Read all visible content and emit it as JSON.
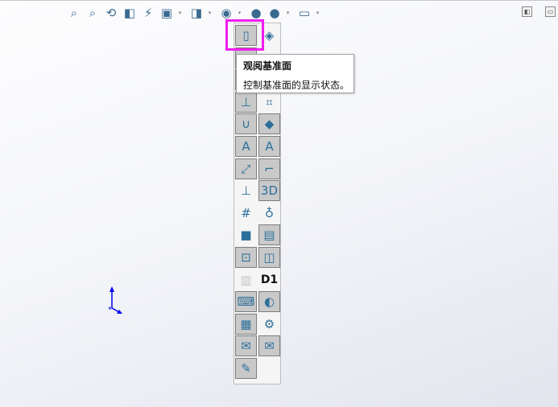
{
  "toolbar": {
    "items": [
      {
        "icon": "zoom-to-fit-icon",
        "glyph": "⌕"
      },
      {
        "icon": "zoom-to-area-icon",
        "glyph": "⌕"
      },
      {
        "icon": "previous-view-icon",
        "glyph": "⟲"
      },
      {
        "icon": "section-view-icon",
        "glyph": "◧"
      },
      {
        "icon": "dynamic-annotation-views-icon",
        "glyph": "⚡"
      },
      {
        "icon": "view-orientation-icon",
        "glyph": "▣"
      },
      {
        "icon": "display-style-icon",
        "glyph": "◨"
      },
      {
        "icon": "hide-show-items-icon",
        "glyph": "◉"
      },
      {
        "icon": "edit-appearance-icon",
        "glyph": "●"
      },
      {
        "icon": "apply-scene-icon",
        "glyph": "●"
      },
      {
        "icon": "view-settings-icon",
        "glyph": "▭"
      }
    ],
    "dropdown_glyph": "▾"
  },
  "window_buttons": [
    "◧",
    "▭"
  ],
  "flyout": {
    "items": [
      {
        "name": "view-planes",
        "glyph": "▯",
        "on": true
      },
      {
        "name": "view-axes",
        "glyph": "◈",
        "on": false
      },
      {
        "name": "hidden-item-1",
        "glyph": "",
        "on": true
      },
      {
        "name": "hidden-item-2",
        "glyph": "",
        "on": false
      },
      {
        "name": "hidden-item-3",
        "glyph": "",
        "on": true
      },
      {
        "name": "hidden-item-4",
        "glyph": "",
        "on": false
      },
      {
        "name": "view-coordinate-systems",
        "glyph": "⊥",
        "on": true
      },
      {
        "name": "view-sketch-text",
        "glyph": "⌗",
        "on": false
      },
      {
        "name": "view-curves",
        "glyph": "∪",
        "on": true
      },
      {
        "name": "view-surfaces",
        "glyph": "◆",
        "on": true
      },
      {
        "name": "view-annotations",
        "glyph": "A",
        "on": true
      },
      {
        "name": "view-all-annotations",
        "glyph": "A",
        "on": true
      },
      {
        "name": "view-dimension-names",
        "glyph": "⤢",
        "on": true
      },
      {
        "name": "view-sketches",
        "glyph": "⌐",
        "on": true
      },
      {
        "name": "view-sketch-relations",
        "glyph": "⊥",
        "on": false
      },
      {
        "name": "view-3d-sketch-planes",
        "glyph": "3D",
        "on": true
      },
      {
        "name": "view-grid",
        "glyph": "#",
        "on": false
      },
      {
        "name": "view-lights",
        "glyph": "♁",
        "on": false
      },
      {
        "name": "view-cameras",
        "glyph": "■",
        "on": false
      },
      {
        "name": "view-decals",
        "glyph": "▤",
        "on": true
      },
      {
        "name": "view-connection-points",
        "glyph": "⊡",
        "on": true
      },
      {
        "name": "view-parts",
        "glyph": "◫",
        "on": true
      },
      {
        "name": "view-disabled-item",
        "glyph": "▥",
        "on": false,
        "disabled": true
      },
      {
        "name": "view-dimension-labels",
        "glyph": "D1",
        "on": false
      },
      {
        "name": "view-routing-points",
        "glyph": "⌨",
        "on": true
      },
      {
        "name": "view-center-of-mass",
        "glyph": "◐",
        "on": true
      },
      {
        "name": "view-weld-beads",
        "glyph": "▦",
        "on": true
      },
      {
        "name": "view-mates",
        "glyph": "⚙",
        "on": false
      },
      {
        "name": "view-markups",
        "glyph": "✉",
        "on": true
      },
      {
        "name": "view-all-markups",
        "glyph": "✉",
        "on": true
      },
      {
        "name": "view-sketch-freeform",
        "glyph": "✎",
        "on": true
      }
    ]
  },
  "tooltip": {
    "title": "观阅基准面",
    "description": "控制基准面的显示状态。"
  }
}
